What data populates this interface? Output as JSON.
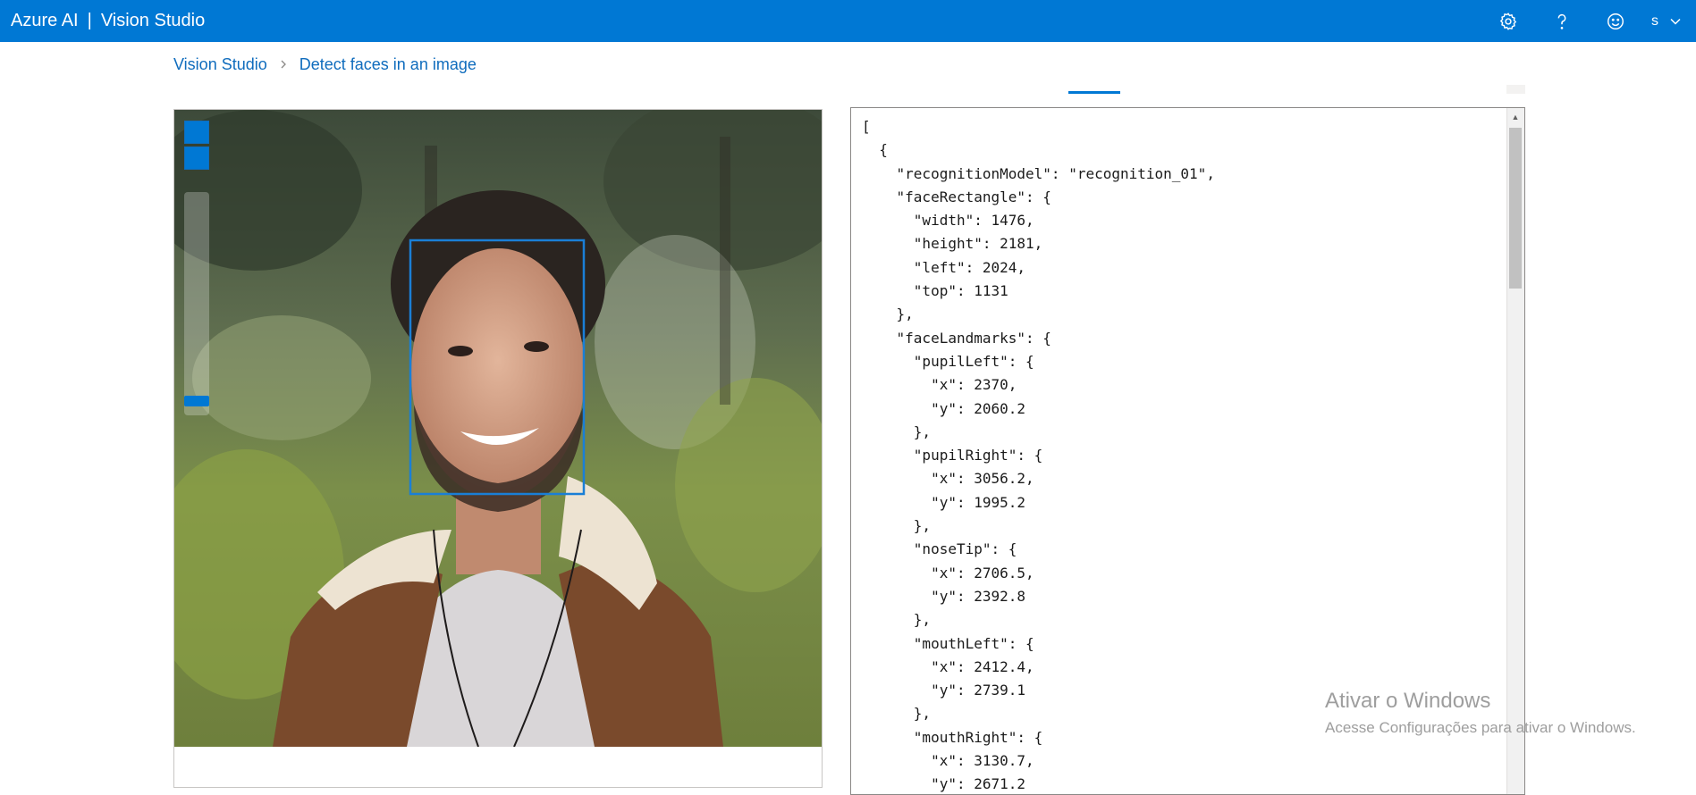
{
  "header": {
    "brand": "Azure AI",
    "separator": "|",
    "product": "Vision Studio",
    "user_initial": "s",
    "icons": [
      "gear-icon",
      "help-icon",
      "feedback-smiley-icon",
      "chevron-down-icon"
    ],
    "background_color": "#0078d4"
  },
  "breadcrumb": {
    "root": "Vision Studio",
    "current": "Detect faces in an image"
  },
  "image_panel": {
    "zoom_controls": [
      "zoom-in-button",
      "zoom-out-button",
      "zoom-slider"
    ],
    "face_box_color": "#0078d4",
    "zoom_level": 0.05
  },
  "json_output": {
    "lines": [
      "[",
      "  {",
      "    \"recognitionModel\": \"recognition_01\",",
      "    \"faceRectangle\": {",
      "      \"width\": 1476,",
      "      \"height\": 2181,",
      "      \"left\": 2024,",
      "      \"top\": 1131",
      "    },",
      "    \"faceLandmarks\": {",
      "      \"pupilLeft\": {",
      "        \"x\": 2370,",
      "        \"y\": 2060.2",
      "      },",
      "      \"pupilRight\": {",
      "        \"x\": 3056.2,",
      "        \"y\": 1995.2",
      "      },",
      "      \"noseTip\": {",
      "        \"x\": 2706.5,",
      "        \"y\": 2392.8",
      "      },",
      "      \"mouthLeft\": {",
      "        \"x\": 2412.4,",
      "        \"y\": 2739.1",
      "      },",
      "      \"mouthRight\": {",
      "        \"x\": 3130.7,",
      "        \"y\": 2671.2"
    ]
  },
  "watermark": {
    "title": "Ativar o Windows",
    "subtitle": "Acesse Configurações para ativar o Windows."
  }
}
